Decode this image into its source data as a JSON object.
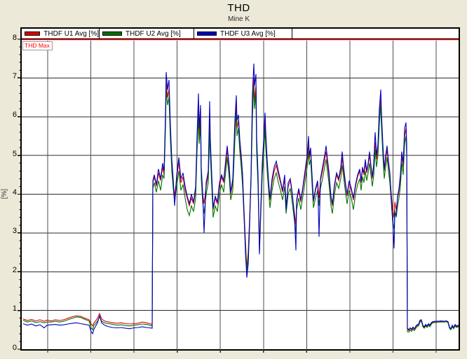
{
  "window": {
    "bg_color": "#ece9d8"
  },
  "header": {
    "title": "THD",
    "subtitle": "Mine K"
  },
  "legend": {
    "items": [
      {
        "label": "THDF U1 Avg [%]",
        "color": "#dd0000"
      },
      {
        "label": "THDF U2 Avg [%]",
        "color": "#007200"
      },
      {
        "label": "THDF U3 Avg [%]",
        "color": "#0000c0"
      }
    ]
  },
  "threshold": {
    "label": "THD Max",
    "value": 8,
    "color": "#ff0000"
  },
  "y_axis": {
    "label": "[%]",
    "min": 0,
    "max": 8,
    "tick_labels": [
      "0",
      "1",
      "2",
      "3",
      "4",
      "5",
      "6",
      "7",
      "8"
    ],
    "minor_tick_step": 0.2
  },
  "x_axis": {
    "tick_labels_visible": false,
    "gridline_count": 10
  },
  "chart_data": {
    "type": "line",
    "title": "THD",
    "subtitle": "Mine K",
    "ylabel": "[%]",
    "ylim": [
      0,
      8.28
    ],
    "grid": true,
    "legend_position": "top",
    "y_gridlines": [
      1,
      2,
      3,
      4,
      5,
      6,
      7
    ],
    "threshold": {
      "label": "THD Max",
      "value": 8
    },
    "x_unit": "plot-relative position 0-623; x tick labels are cut off in the screenshot",
    "x_gridlines": [
      37,
      98.6,
      160.1,
      221.7,
      283.2,
      344.8,
      406.3,
      467.9,
      529.4,
      591
    ],
    "series": [
      {
        "name": "THDF U1 Avg [%]",
        "color": "#dd0000"
      },
      {
        "name": "THDF U2 Avg [%]",
        "color": "#007200"
      },
      {
        "name": "THDF U3 Avg [%]",
        "color": "#0000c0"
      }
    ],
    "points": [
      [
        2,
        0.78,
        0.74,
        0.66
      ],
      [
        8,
        0.74,
        0.7,
        0.62
      ],
      [
        14,
        0.77,
        0.73,
        0.65
      ],
      [
        20,
        0.73,
        0.69,
        0.6
      ],
      [
        26,
        0.76,
        0.71,
        0.63
      ],
      [
        32,
        0.72,
        0.68,
        0.55
      ],
      [
        36,
        0.75,
        0.7,
        0.62
      ],
      [
        42,
        0.73,
        0.7,
        0.63
      ],
      [
        48,
        0.76,
        0.72,
        0.64
      ],
      [
        54,
        0.74,
        0.7,
        0.62
      ],
      [
        60,
        0.76,
        0.72,
        0.63
      ],
      [
        66,
        0.8,
        0.76,
        0.65
      ],
      [
        72,
        0.84,
        0.8,
        0.67
      ],
      [
        78,
        0.86,
        0.83,
        0.68
      ],
      [
        84,
        0.85,
        0.82,
        0.66
      ],
      [
        90,
        0.8,
        0.77,
        0.64
      ],
      [
        96,
        0.76,
        0.73,
        0.62
      ],
      [
        99,
        0.65,
        0.55,
        0.45
      ],
      [
        101,
        0.6,
        0.5,
        0.4
      ],
      [
        103,
        0.68,
        0.62,
        0.52
      ],
      [
        105,
        0.72,
        0.66,
        0.58
      ],
      [
        108,
        0.8,
        0.72,
        0.68
      ],
      [
        111,
        0.92,
        0.84,
        0.86
      ],
      [
        114,
        0.78,
        0.72,
        0.68
      ],
      [
        118,
        0.73,
        0.68,
        0.62
      ],
      [
        124,
        0.7,
        0.66,
        0.58
      ],
      [
        130,
        0.68,
        0.64,
        0.56
      ],
      [
        136,
        0.67,
        0.62,
        0.55
      ],
      [
        142,
        0.68,
        0.63,
        0.56
      ],
      [
        148,
        0.66,
        0.61,
        0.54
      ],
      [
        154,
        0.65,
        0.6,
        0.53
      ],
      [
        160,
        0.66,
        0.62,
        0.55
      ],
      [
        166,
        0.67,
        0.63,
        0.56
      ],
      [
        172,
        0.7,
        0.65,
        0.58
      ],
      [
        178,
        0.68,
        0.64,
        0.56
      ],
      [
        183,
        0.66,
        0.62,
        0.55
      ],
      [
        186,
        0.64,
        0.6,
        0.54
      ],
      [
        187,
        4.3,
        4.15,
        4.35
      ],
      [
        189,
        4.45,
        4.3,
        4.5
      ],
      [
        192,
        4.2,
        4.05,
        4.25
      ],
      [
        195,
        4.55,
        4.35,
        4.65
      ],
      [
        198,
        4.35,
        4.1,
        4.4
      ],
      [
        201,
        4.7,
        4.5,
        4.8
      ],
      [
        203,
        4.5,
        4.4,
        4.6
      ],
      [
        205,
        5.9,
        5.7,
        6.1
      ],
      [
        206,
        6.9,
        6.7,
        7.15
      ],
      [
        208,
        6.5,
        6.3,
        6.7
      ],
      [
        210,
        6.7,
        6.5,
        6.95
      ],
      [
        212,
        5.6,
        5.4,
        5.8
      ],
      [
        214,
        4.75,
        4.6,
        4.9
      ],
      [
        216,
        4.3,
        4.15,
        4.4
      ],
      [
        218,
        3.95,
        3.8,
        3.7
      ],
      [
        221,
        4.4,
        4.2,
        4.5
      ],
      [
        224,
        4.85,
        4.6,
        4.95
      ],
      [
        227,
        4.3,
        4.1,
        4.4
      ],
      [
        230,
        4.45,
        4.25,
        4.55
      ],
      [
        233,
        4.1,
        3.9,
        4.2
      ],
      [
        236,
        3.9,
        3.6,
        3.95
      ],
      [
        239,
        3.7,
        3.45,
        3.75
      ],
      [
        242,
        3.9,
        3.7,
        4.0
      ],
      [
        245,
        3.75,
        3.55,
        3.8
      ],
      [
        248,
        4.1,
        3.9,
        4.2
      ],
      [
        250,
        5.3,
        5.1,
        5.5
      ],
      [
        252,
        6.2,
        6.0,
        6.6
      ],
      [
        253,
        5.5,
        5.3,
        5.7
      ],
      [
        255,
        6.0,
        5.8,
        6.3
      ],
      [
        256,
        4.6,
        4.4,
        4.7
      ],
      [
        258,
        4.0,
        3.8,
        4.05
      ],
      [
        260,
        3.75,
        3.5,
        3.0
      ],
      [
        263,
        4.2,
        4.0,
        4.3
      ],
      [
        266,
        4.5,
        4.3,
        4.6
      ],
      [
        268,
        5.9,
        5.6,
        6.4
      ],
      [
        269,
        5.2,
        5.0,
        5.4
      ],
      [
        271,
        4.4,
        4.2,
        4.5
      ],
      [
        273,
        3.6,
        3.4,
        3.65
      ],
      [
        276,
        3.9,
        3.7,
        3.95
      ],
      [
        279,
        3.75,
        3.55,
        3.8
      ],
      [
        282,
        4.2,
        4.0,
        4.3
      ],
      [
        285,
        4.45,
        4.25,
        4.5
      ],
      [
        288,
        4.3,
        4.05,
        4.35
      ],
      [
        291,
        4.8,
        4.6,
        4.9
      ],
      [
        293,
        5.15,
        4.95,
        5.25
      ],
      [
        296,
        4.6,
        4.4,
        4.7
      ],
      [
        298,
        4.0,
        3.85,
        4.05
      ],
      [
        301,
        4.3,
        4.1,
        4.4
      ],
      [
        304,
        5.6,
        5.4,
        5.9
      ],
      [
        306,
        6.3,
        6.1,
        6.55
      ],
      [
        307,
        5.7,
        5.5,
        5.9
      ],
      [
        309,
        5.9,
        5.7,
        6.05
      ],
      [
        311,
        5.3,
        5.1,
        5.4
      ],
      [
        313,
        4.9,
        4.7,
        5.0
      ],
      [
        315,
        4.4,
        4.2,
        4.5
      ],
      [
        317,
        3.6,
        3.4,
        3.5
      ],
      [
        319,
        2.8,
        2.7,
        2.5
      ],
      [
        321,
        2.1,
        2.0,
        1.85
      ],
      [
        323,
        2.5,
        2.4,
        2.2
      ],
      [
        325,
        3.4,
        3.3,
        3.2
      ],
      [
        327,
        4.4,
        4.3,
        4.5
      ],
      [
        329,
        6.2,
        6.0,
        6.6
      ],
      [
        331,
        7.0,
        6.8,
        7.37
      ],
      [
        332,
        6.4,
        6.2,
        6.8
      ],
      [
        334,
        6.8,
        6.6,
        7.1
      ],
      [
        335,
        5.3,
        5.1,
        5.5
      ],
      [
        337,
        4.4,
        4.2,
        4.5
      ],
      [
        339,
        2.7,
        2.5,
        2.45
      ],
      [
        341,
        3.6,
        3.5,
        3.7
      ],
      [
        343,
        4.7,
        4.5,
        4.8
      ],
      [
        345,
        5.2,
        5.0,
        5.4
      ],
      [
        347,
        5.9,
        5.7,
        6.1
      ],
      [
        348,
        5.4,
        5.2,
        5.6
      ],
      [
        350,
        4.8,
        4.6,
        4.9
      ],
      [
        352,
        4.3,
        4.1,
        4.35
      ],
      [
        354,
        3.85,
        3.65,
        3.9
      ],
      [
        357,
        4.3,
        4.1,
        4.4
      ],
      [
        360,
        4.6,
        4.4,
        4.7
      ],
      [
        363,
        4.75,
        4.55,
        4.85
      ],
      [
        366,
        4.5,
        4.3,
        4.6
      ],
      [
        369,
        4.3,
        4.1,
        4.35
      ],
      [
        372,
        4.05,
        3.85,
        4.1
      ],
      [
        375,
        4.4,
        4.2,
        4.5
      ],
      [
        377,
        3.7,
        3.5,
        3.6
      ],
      [
        380,
        4.2,
        4.0,
        4.3
      ],
      [
        383,
        4.35,
        4.15,
        4.4
      ],
      [
        386,
        3.95,
        3.75,
        4.0
      ],
      [
        389,
        3.5,
        3.3,
        3.4
      ],
      [
        391,
        3.2,
        3.0,
        2.55
      ],
      [
        392,
        3.8,
        3.6,
        3.85
      ],
      [
        395,
        4.1,
        3.9,
        4.15
      ],
      [
        398,
        3.8,
        3.6,
        3.85
      ],
      [
        401,
        4.15,
        3.95,
        4.2
      ],
      [
        404,
        4.5,
        4.3,
        4.6
      ],
      [
        407,
        4.9,
        4.7,
        5.0
      ],
      [
        409,
        5.3,
        5.1,
        5.5
      ],
      [
        410,
        4.9,
        4.75,
        5.0
      ],
      [
        412,
        5.1,
        4.9,
        5.2
      ],
      [
        414,
        4.4,
        4.25,
        4.5
      ],
      [
        416,
        3.8,
        3.65,
        3.85
      ],
      [
        419,
        4.1,
        3.9,
        4.15
      ],
      [
        422,
        4.3,
        4.1,
        4.35
      ],
      [
        424,
        3.9,
        3.7,
        2.9
      ],
      [
        426,
        4.35,
        4.15,
        4.4
      ],
      [
        429,
        4.6,
        4.4,
        4.7
      ],
      [
        432,
        4.9,
        4.7,
        5.0
      ],
      [
        434,
        5.1,
        4.9,
        5.25
      ],
      [
        436,
        4.8,
        4.6,
        4.9
      ],
      [
        438,
        4.5,
        4.3,
        4.6
      ],
      [
        441,
        3.9,
        3.7,
        3.95
      ],
      [
        443,
        3.7,
        3.5,
        3.75
      ],
      [
        446,
        4.2,
        4.0,
        4.25
      ],
      [
        449,
        4.5,
        4.3,
        4.55
      ],
      [
        452,
        4.35,
        4.15,
        4.4
      ],
      [
        455,
        4.6,
        4.4,
        4.7
      ],
      [
        457,
        4.95,
        4.75,
        5.1
      ],
      [
        459,
        4.6,
        4.45,
        4.7
      ],
      [
        462,
        4.2,
        4.0,
        4.25
      ],
      [
        464,
        3.95,
        3.75,
        4.0
      ],
      [
        467,
        4.3,
        4.1,
        4.35
      ],
      [
        470,
        4.1,
        3.9,
        4.15
      ],
      [
        473,
        3.85,
        3.6,
        3.9
      ],
      [
        476,
        4.2,
        4.0,
        4.25
      ],
      [
        479,
        4.45,
        4.25,
        4.5
      ],
      [
        482,
        4.6,
        4.4,
        4.65
      ],
      [
        484,
        4.3,
        4.1,
        4.35
      ],
      [
        486,
        4.65,
        4.45,
        4.7
      ],
      [
        488,
        4.5,
        4.3,
        4.55
      ],
      [
        490,
        4.8,
        4.6,
        4.9
      ],
      [
        492,
        4.55,
        4.35,
        4.6
      ],
      [
        494,
        4.75,
        4.55,
        4.8
      ],
      [
        496,
        5.0,
        4.8,
        5.1
      ],
      [
        498,
        4.7,
        4.5,
        4.75
      ],
      [
        500,
        4.4,
        4.2,
        4.45
      ],
      [
        502,
        4.7,
        4.5,
        4.8
      ],
      [
        504,
        5.35,
        5.15,
        5.6
      ],
      [
        506,
        4.9,
        4.7,
        5.0
      ],
      [
        508,
        5.2,
        5.0,
        5.3
      ],
      [
        510,
        6.0,
        5.8,
        6.2
      ],
      [
        512,
        6.45,
        6.3,
        6.7
      ],
      [
        513,
        5.9,
        5.75,
        6.1
      ],
      [
        515,
        5.2,
        5.0,
        5.3
      ],
      [
        517,
        4.6,
        4.4,
        4.65
      ],
      [
        519,
        4.9,
        4.7,
        5.0
      ],
      [
        521,
        5.15,
        4.95,
        5.25
      ],
      [
        523,
        4.8,
        4.6,
        4.85
      ],
      [
        525,
        4.5,
        4.3,
        4.55
      ],
      [
        527,
        4.0,
        3.8,
        3.9
      ],
      [
        529,
        3.6,
        3.3,
        3.3
      ],
      [
        531,
        3.4,
        3.1,
        2.6
      ],
      [
        532,
        3.8,
        3.6,
        3.5
      ],
      [
        534,
        3.6,
        3.4,
        3.45
      ],
      [
        536,
        3.9,
        3.7,
        3.95
      ],
      [
        538,
        4.1,
        3.9,
        4.15
      ],
      [
        540,
        4.4,
        4.2,
        4.5
      ],
      [
        542,
        5.0,
        4.8,
        5.1
      ],
      [
        544,
        4.7,
        4.5,
        4.8
      ],
      [
        546,
        5.5,
        5.3,
        5.7
      ],
      [
        548,
        5.7,
        5.5,
        5.85
      ],
      [
        549,
        5.2,
        5.0,
        5.3
      ],
      [
        550,
        0.52,
        0.45,
        0.55
      ],
      [
        552,
        0.48,
        0.44,
        0.5
      ],
      [
        554,
        0.55,
        0.5,
        0.55
      ],
      [
        556,
        0.5,
        0.46,
        0.52
      ],
      [
        558,
        0.55,
        0.52,
        0.57
      ],
      [
        560,
        0.52,
        0.48,
        0.53
      ],
      [
        563,
        0.6,
        0.57,
        0.62
      ],
      [
        566,
        0.63,
        0.6,
        0.65
      ],
      [
        568,
        0.72,
        0.7,
        0.75
      ],
      [
        570,
        0.74,
        0.72,
        0.76
      ],
      [
        572,
        0.6,
        0.58,
        0.62
      ],
      [
        574,
        0.56,
        0.54,
        0.58
      ],
      [
        576,
        0.62,
        0.6,
        0.64
      ],
      [
        578,
        0.58,
        0.56,
        0.6
      ],
      [
        580,
        0.64,
        0.62,
        0.66
      ],
      [
        582,
        0.6,
        0.58,
        0.62
      ],
      [
        584,
        0.66,
        0.64,
        0.68
      ],
      [
        586,
        0.7,
        0.68,
        0.71
      ],
      [
        590,
        0.71,
        0.69,
        0.72
      ],
      [
        594,
        0.71,
        0.7,
        0.72
      ],
      [
        598,
        0.72,
        0.7,
        0.73
      ],
      [
        602,
        0.71,
        0.7,
        0.72
      ],
      [
        606,
        0.72,
        0.71,
        0.73
      ],
      [
        608,
        0.7,
        0.68,
        0.71
      ],
      [
        610,
        0.56,
        0.54,
        0.57
      ],
      [
        612,
        0.52,
        0.5,
        0.53
      ],
      [
        614,
        0.6,
        0.58,
        0.62
      ],
      [
        616,
        0.55,
        0.53,
        0.56
      ],
      [
        618,
        0.62,
        0.6,
        0.64
      ],
      [
        620,
        0.58,
        0.56,
        0.6
      ],
      [
        623,
        0.6,
        0.58,
        0.62
      ]
    ]
  }
}
